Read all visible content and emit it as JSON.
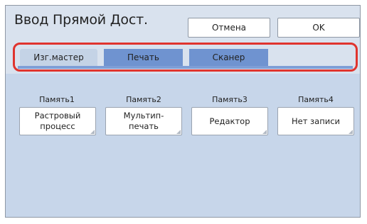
{
  "header": {
    "title": "Ввод Прямой Дост.",
    "cancel_label": "Отмена",
    "ok_label": "OK"
  },
  "tabs": [
    {
      "label": "Изг.мастер",
      "active": true
    },
    {
      "label": "Печать",
      "active": false
    },
    {
      "label": "Сканер",
      "active": false
    }
  ],
  "memories": [
    {
      "label": "Память1",
      "button": "Растровый\nпроцесс"
    },
    {
      "label": "Память2",
      "button": "Мультип-\nпечать"
    },
    {
      "label": "Память3",
      "button": "Редактор"
    },
    {
      "label": "Память4",
      "button": "Нет записи"
    }
  ],
  "colors": {
    "tab_highlight_border": "#e0342e",
    "active_tab": "#c4d3e6",
    "inactive_tab": "#6f93d0",
    "panel_background": "#c7d6ea"
  }
}
